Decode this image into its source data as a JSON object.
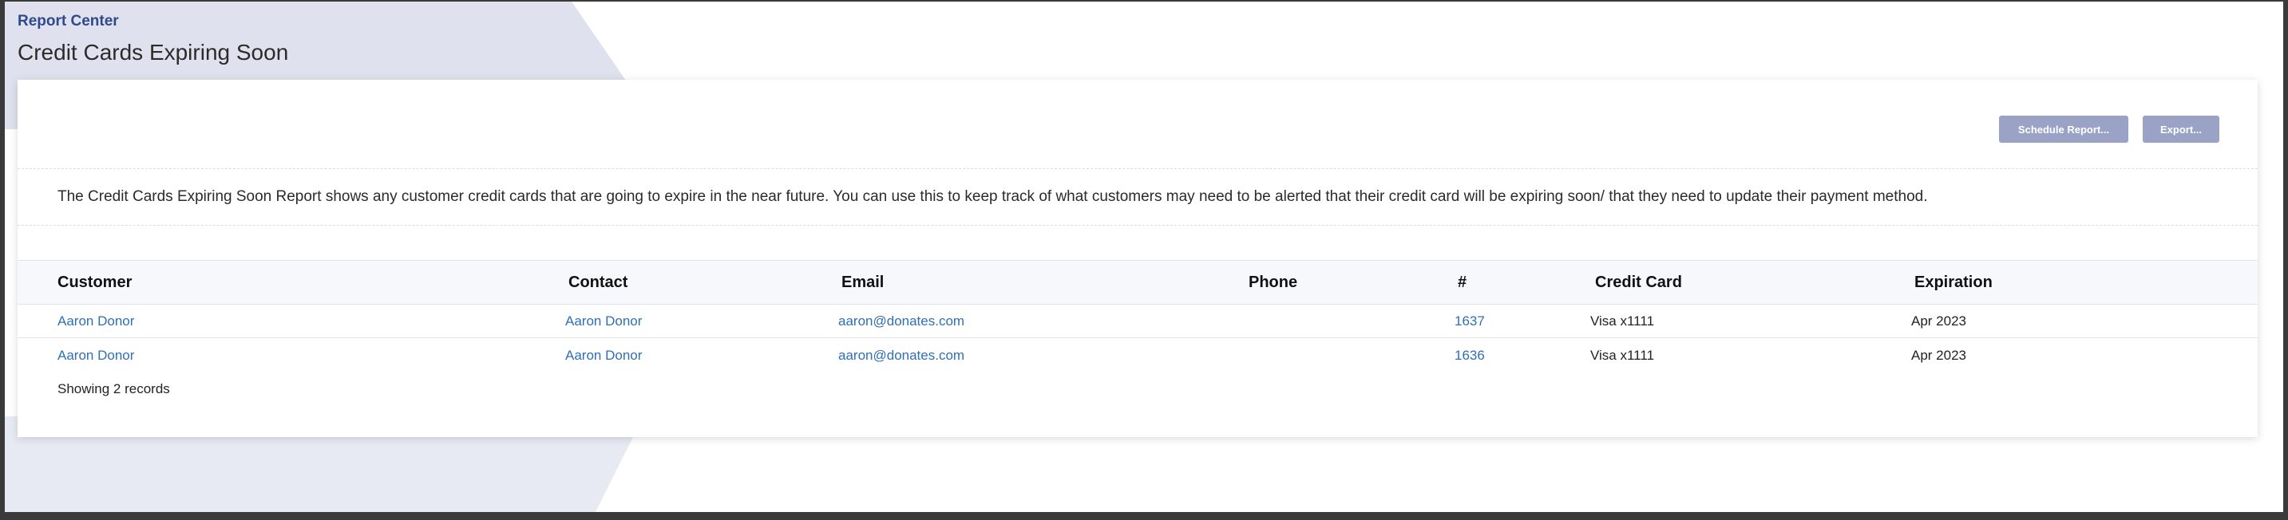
{
  "header": {
    "breadcrumb": "Report Center",
    "title": "Credit Cards Expiring Soon"
  },
  "toolbar": {
    "schedule_label": "Schedule Report...",
    "export_label": "Export..."
  },
  "description": "The Credit Cards Expiring Soon Report shows any customer credit cards that are going to expire in the near future. You can use this to keep track of what customers may need to be alerted that their credit card will be expiring soon/ that they need to update their payment method.",
  "table": {
    "columns": [
      "Customer",
      "Contact",
      "Email",
      "Phone",
      "#",
      "Credit Card",
      "Expiration"
    ],
    "rows": [
      {
        "customer": "Aaron Donor",
        "contact": "Aaron Donor",
        "email": "aaron@donates.com",
        "phone": "",
        "number": "1637",
        "credit_card": "Visa x1111",
        "expiration": "Apr 2023"
      },
      {
        "customer": "Aaron Donor",
        "contact": "Aaron Donor",
        "email": "aaron@donates.com",
        "phone": "",
        "number": "1636",
        "credit_card": "Visa x1111",
        "expiration": "Apr 2023"
      }
    ],
    "footer": "Showing 2 records"
  },
  "colors": {
    "accent": "#2f4a8a",
    "link": "#2f6fb5",
    "button": "#9aa3c6",
    "background_shape": "#dfe1ee"
  }
}
